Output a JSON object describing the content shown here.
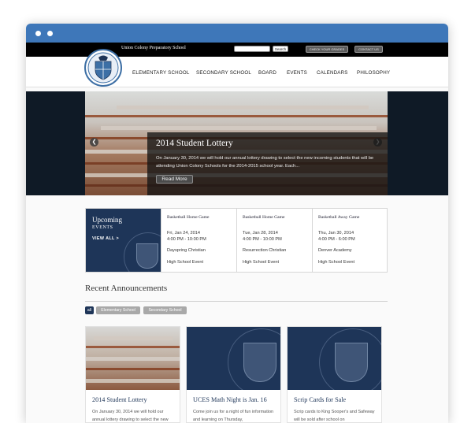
{
  "header": {
    "school_name": "Union Colony Preparatory School",
    "search_label": "Search",
    "grades_button": "CHECK YOUR GRADES",
    "contact_button": "CONTACT US"
  },
  "nav": {
    "items": [
      "ELEMENTARY SCHOOL",
      "SECONDARY SCHOOL",
      "BOARD",
      "EVENTS",
      "CALENDARS",
      "PHILOSOPHY"
    ]
  },
  "hero": {
    "title": "2014 Student Lottery",
    "text": "On January 30, 2014 we will hold our annual lottery drawing to select the new incoming students that will be attending Union Colony Schools for the 2014-2015 school year.  Each...",
    "read_more": "Read More",
    "prev_arrow": "❮",
    "next_arrow": "❯"
  },
  "events": {
    "title": "Upcoming",
    "subtitle": "EVENTS",
    "view_all": "VIEW ALL  >",
    "items": [
      {
        "title": "Basketball Home Game",
        "date": "Fri, Jan 24, 2014",
        "time": "4:00 PM - 10:00 PM",
        "opponent": "Dayspring Christian",
        "kind": "High School Event"
      },
      {
        "title": "Basketball Home Game",
        "date": "Tue, Jan 28, 2014",
        "time": "4:00 PM - 10:00 PM",
        "opponent": "Resurrection Christian",
        "kind": "High School Event"
      },
      {
        "title": "Basketball Away Game",
        "date": "Thu, Jan 30, 2014",
        "time": "4:00 PM - 6:00 PM",
        "opponent": "Denver Academy",
        "kind": "High School Event"
      }
    ]
  },
  "announcements": {
    "heading": "Recent Announcements",
    "filters": [
      "all",
      "Elementary School",
      "Secondary School"
    ],
    "cards": [
      {
        "title": "2014 Student Lottery",
        "text": "On January 30, 2014 we will hold our annual lottery drawing to select the new"
      },
      {
        "title": "UCES Math Night is Jan. 16",
        "text": "Come join us for a night of fun information and learning on Thursday,"
      },
      {
        "title": "Scrip Cards for Sale",
        "text": "Scrip cards to King Sooper's and Safeway will be sold after school on"
      }
    ]
  },
  "colors": {
    "chrome": "#3e77b9",
    "navy": "#1e3558",
    "topbar": "#000000"
  }
}
